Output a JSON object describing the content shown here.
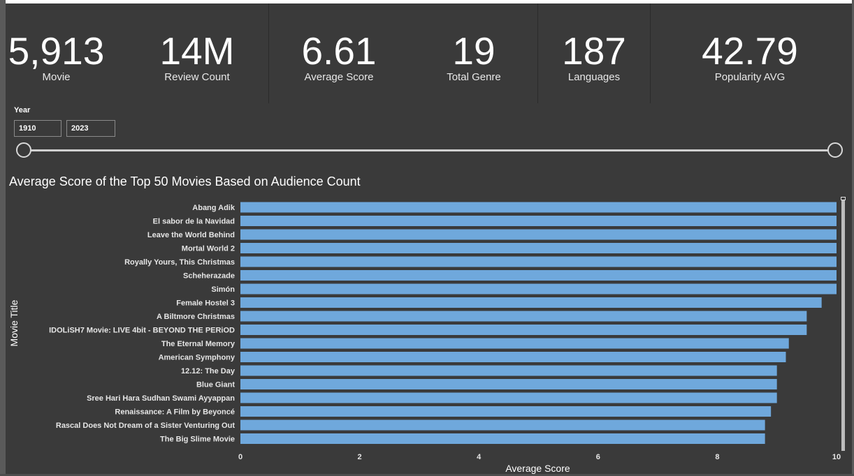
{
  "kpis": [
    {
      "value": "5,913",
      "label": "Movie"
    },
    {
      "value": "14M",
      "label": "Review Count"
    },
    {
      "value": "6.61",
      "label": "Average Score"
    },
    {
      "value": "19",
      "label": "Total Genre"
    },
    {
      "value": "187",
      "label": "Languages"
    },
    {
      "value": "42.79",
      "label": "Popularity AVG"
    }
  ],
  "year_filter": {
    "label": "Year",
    "start": "1910",
    "end": "2023"
  },
  "colors": {
    "bar": "#6fa8dc",
    "background": "#3a3a3a"
  },
  "chart_data": {
    "type": "bar",
    "orientation": "horizontal",
    "title": "Average Score of the Top 50 Movies Based on Audience Count",
    "xlabel": "Average Score",
    "ylabel": "Movie Title",
    "xlim": [
      0,
      10
    ],
    "xticks": [
      "0",
      "2",
      "4",
      "6",
      "8",
      "10"
    ],
    "grid": false,
    "categories": [
      "Abang Adik",
      "El sabor de la Navidad",
      "Leave the World Behind",
      "Mortal World 2",
      "Royally Yours, This Christmas",
      "Scheherazade",
      "Simón",
      "Female Hostel 3",
      "A Biltmore Christmas",
      "IDOLiSH7 Movie: LIVE 4bit - BEYOND THE PERiOD",
      "The Eternal Memory",
      "American Symphony",
      "12.12: The Day",
      "Blue Giant",
      "Sree Hari Hara Sudhan Swami Ayyappan",
      "Renaissance: A Film by Beyoncé",
      "Rascal Does Not Dream of a Sister Venturing Out",
      "The Big Slime Movie"
    ],
    "values": [
      10.0,
      10.0,
      10.0,
      10.0,
      10.0,
      10.0,
      10.0,
      9.75,
      9.5,
      9.5,
      9.2,
      9.15,
      9.0,
      9.0,
      9.0,
      8.9,
      8.8,
      8.8
    ]
  }
}
